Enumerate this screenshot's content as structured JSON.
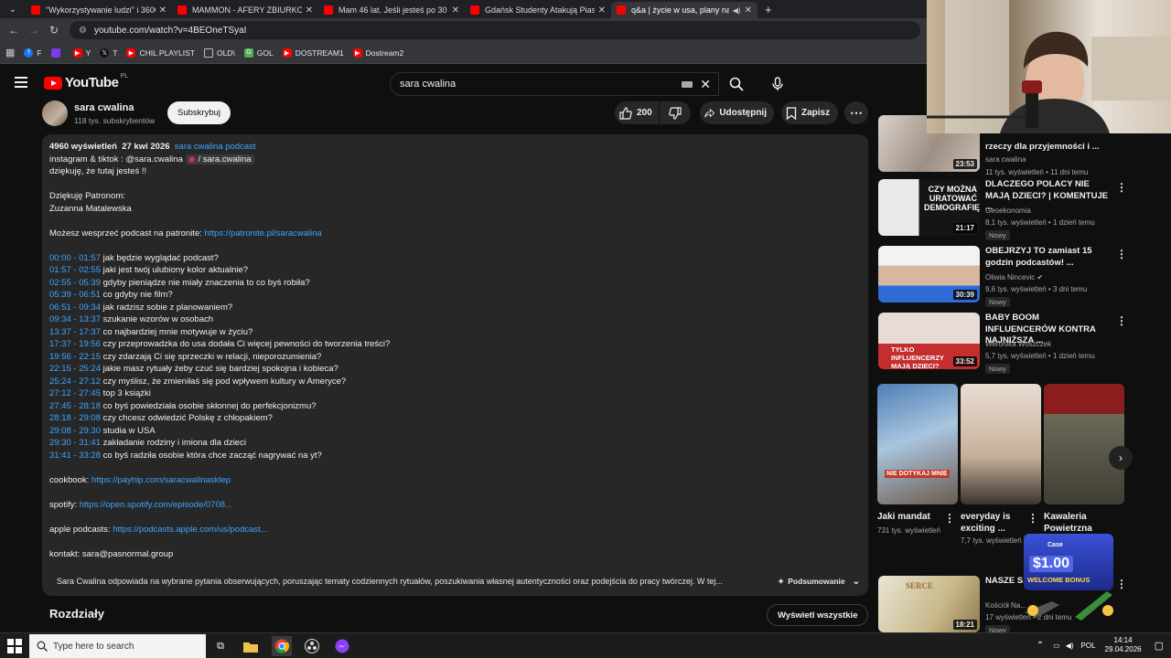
{
  "browser": {
    "tabs": [
      {
        "title": "\"Wykorzystywanie ludzi\" i 3600 zł",
        "active": false,
        "color": "#ff0000"
      },
      {
        "title": "MAMMON - AFERY ZBIURKOWE",
        "active": false,
        "color": "#ff0000"
      },
      {
        "title": "Mam 46 lat. Jeśli jesteś po 30 r.ż",
        "active": false,
        "color": "#ff0000"
      },
      {
        "title": "Gdańsk Studenty Atakują Piastów",
        "active": false,
        "color": "#ff0000"
      },
      {
        "title": "q&a | życie w usa, plany na",
        "active": true,
        "color": "#ff0000"
      }
    ],
    "url": "youtube.com/watch?v=4BEOneTSyaI",
    "bookmarks": [
      {
        "label": "F",
        "color": "#1877f2"
      },
      {
        "label": "",
        "color": "#7c3aed"
      },
      {
        "label": "Y",
        "color": "#ff0000"
      },
      {
        "label": "T",
        "color": "#111111"
      },
      {
        "label": "CHIL PLAYLIST",
        "color": "#ff0000"
      },
      {
        "label": "OLD\\",
        "color": "#666666"
      },
      {
        "label": "GOL",
        "color": "#4caf50"
      },
      {
        "label": "DOSTREAM1",
        "color": "#ff0000"
      },
      {
        "label": "Dostream2",
        "color": "#ff0000"
      }
    ]
  },
  "yt": {
    "logo": "YouTube",
    "country": "PL",
    "search_value": "sara cwalina"
  },
  "channel": {
    "name": "sara cwalina",
    "subs": "118 tys. subskrybentów",
    "subscribe": "Subskrybuj",
    "likes": "200",
    "share": "Udostępnij",
    "save": "Zapisz"
  },
  "description": {
    "views": "4960 wyświetleń",
    "date": "27 kwi 2026",
    "tag": "sara cwalina podcast",
    "line1_prefix": "instagram & tiktok : @sara.cwalina",
    "line1_link": "/ sara.cwalina",
    "line2": "dziękuję, że tutaj jesteś !!",
    "patrons_title": "Dziękuję Patronom:",
    "patrons_name": "Zuzanna Matalewska",
    "support_text": "Możesz wesprzeć podcast na patronite:",
    "support_link": "https://patronite.pl/saracwalina",
    "chapters": [
      {
        "t": "00:00 - 01:57",
        "txt": "jak będzie wyglądać podcast?"
      },
      {
        "t": "01:57 - 02:55",
        "txt": "jaki jest twój ulubiony kolor aktualnie?"
      },
      {
        "t": "02:55 - 05:39",
        "txt": "gdyby pieniądze nie miały znaczenia to co byś robiła?"
      },
      {
        "t": "05:39 - 06:51",
        "txt": "co gdyby nie film?"
      },
      {
        "t": "06:51 - 09:34",
        "txt": "jak radzisz sobie z planowaniem?"
      },
      {
        "t": "09:34 - 13:37",
        "txt": "szukanie wzorów w osobach"
      },
      {
        "t": "13:37 - 17:37",
        "txt": "co najbardziej mnie motywuje w życiu?"
      },
      {
        "t": "17:37 - 19:56",
        "txt": "czy przeprowadzka do usa dodała Ci więcej pewności do tworzenia treści?"
      },
      {
        "t": "19:56 - 22:15",
        "txt": "czy zdarzają Ci się sprzeczki w relacji, nieporozumienia?"
      },
      {
        "t": "22:15 - 25:24",
        "txt": "jakie masz rytuały żeby czuć się bardziej spokojna i kobieca?"
      },
      {
        "t": "25:24 - 27:12",
        "txt": "czy myślisz, że zmieniłaś się pod wpływem kultury w Ameryce?"
      },
      {
        "t": "27:12 - 27:45",
        "txt": "top 3 książki"
      },
      {
        "t": "27:45 - 28:18",
        "txt": "co byś powiedziała osobie skłonnej do perfekcjonizmu?"
      },
      {
        "t": "28:18 - 29:08",
        "txt": "czy chcesz odwiedzić Polskę z chłopakiem?"
      },
      {
        "t": "29:08 - 29:30",
        "txt": "studia w USA"
      },
      {
        "t": "29:30 - 31:41",
        "txt": "zakładanie rodziny i imiona dla dzieci"
      },
      {
        "t": "31:41 - 33:28",
        "txt": "co byś radziła osobie która chce zacząć nagrywać na yt?"
      }
    ],
    "cookbook_label": "cookbook:",
    "cookbook_link": "https://payhip.com/saracwalinasklep",
    "spotify_label": "spotify:",
    "spotify_link": "https://open.spotify.com/episode/0708...",
    "apple_label": "apple podcasts:",
    "apple_link": "https://podcasts.apple.com/us/podcast...",
    "contact": "kontakt: sara@pasnormal.group",
    "summary": "Sara Cwalina odpowiada na wybrane pytania obserwujących, poruszając tematy codziennych rytuałów, poszukiwania własnej autentyczności oraz podejścia do pracy twórczej. W tej...",
    "summary_btn": "Podsumowanie"
  },
  "chapters_section": {
    "title": "Rozdziały",
    "show_all": "Wyświetl wszystkie"
  },
  "recs": [
    {
      "title": "rzeczy dla przyjemności i ...",
      "channel": "sara cwalina",
      "meta": "11 tys. wyświetleń • 11 dni temu",
      "dur": "23:53",
      "nowy": ""
    },
    {
      "title": "DLACZEGO POLACY NIE MAJĄ DZIECI? | KOMENTUJE ...",
      "channel": "Geoekonomia",
      "meta": "8,1 tys. wyświetleń • 1 dzień temu",
      "dur": "21:17",
      "nowy": "Nowy",
      "thumb_text": "CZY MOŻNA URATOWAĆ DEMOGRAFIĘ?"
    },
    {
      "title": "OBEJRZYJ TO zamiast 15 godzin podcastów! ...",
      "channel": "Oliwia Nincevic",
      "meta": "9,6 tys. wyświetleń • 3 dni temu",
      "dur": "30:39",
      "nowy": "Nowy"
    },
    {
      "title": "BABY BOOM INFLUENCERÓW KONTRA NAJNIŻSZA ...",
      "channel": "Weronika Woszczek",
      "meta": "5,7 tys. wyświetleń • 1 dzień temu",
      "dur": "33:52",
      "nowy": "Nowy",
      "thumb_text": "TYLKO INFLUENCERZY MAJĄ DZIECI?"
    }
  ],
  "shorts": [
    {
      "title": "Jaki mandat",
      "views": "731 tys. wyświetleń",
      "overlay": "NIE DOTYKAJ MNIE"
    },
    {
      "title": "everyday is exciting ...",
      "views": "7,7 tys. wyświetleń",
      "overlay": ""
    },
    {
      "title": "Kawaleria Powietrzna",
      "views": "",
      "overlay": ""
    }
  ],
  "last_rec": {
    "title": "NASZE S...",
    "channel": "Kościół Na...",
    "meta": "17 wyświetleń • 2 dni temu",
    "dur": "18:21",
    "nowy": "Nowy",
    "thumb_text": "SERCE"
  },
  "ad": {
    "brand": "Case",
    "amount": "$1.00",
    "bonus": "WELCOME BONUS"
  },
  "taskbar": {
    "search_placeholder": "Type here to search",
    "lang": "POL",
    "time": "14:14",
    "date": "29.04.2026"
  }
}
